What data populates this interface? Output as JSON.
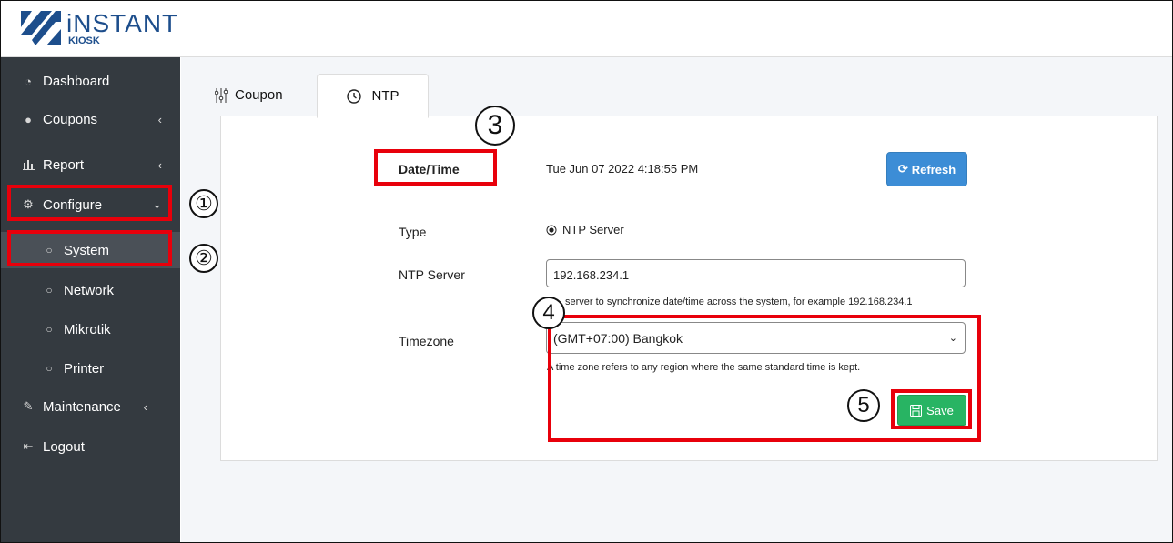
{
  "logo": {
    "line1": "iNSTANT",
    "line2": "KIOSK"
  },
  "sidebar": {
    "items": [
      {
        "label": "Dashboard",
        "icon": "dashboard-icon"
      },
      {
        "label": "Coupons",
        "icon": "tag-icon"
      },
      {
        "label": "Report",
        "icon": "bar-chart-icon"
      },
      {
        "label": "Configure",
        "icon": "gear-icon"
      },
      {
        "label": "System",
        "icon": "circle-icon"
      },
      {
        "label": "Network",
        "icon": "circle-icon"
      },
      {
        "label": "Mikrotik",
        "icon": "circle-icon"
      },
      {
        "label": "Printer",
        "icon": "circle-icon"
      },
      {
        "label": "Maintenance",
        "icon": "wrench-icon"
      },
      {
        "label": "Logout",
        "icon": "logout-icon"
      }
    ]
  },
  "tabs": [
    {
      "label": "Coupon",
      "icon": "sliders-icon"
    },
    {
      "label": "NTP",
      "icon": "clock-icon"
    }
  ],
  "form": {
    "datetime_label": "Date/Time",
    "datetime_value": "Tue Jun 07 2022 4:18:55 PM",
    "refresh_label": "Refresh",
    "type_label": "Type",
    "type_option": "NTP Server",
    "ntp_label": "NTP Server",
    "ntp_value": "192.168.234.1",
    "ntp_help": "server to synchronize date/time across the system, for example 192.168.234.1",
    "timezone_label": "Timezone",
    "timezone_value": "(GMT+07:00) Bangkok",
    "timezone_help": "A time zone refers to any region where the same standard time is kept.",
    "save_label": "Save"
  },
  "annotations": {
    "step1": "①",
    "step2": "②",
    "step3": "3",
    "step4": "4",
    "step5": "5"
  },
  "colors": {
    "sidebar": "#343a40",
    "refresh": "#3c8dd6",
    "save": "#28b463",
    "highlight": "#e8000b"
  }
}
